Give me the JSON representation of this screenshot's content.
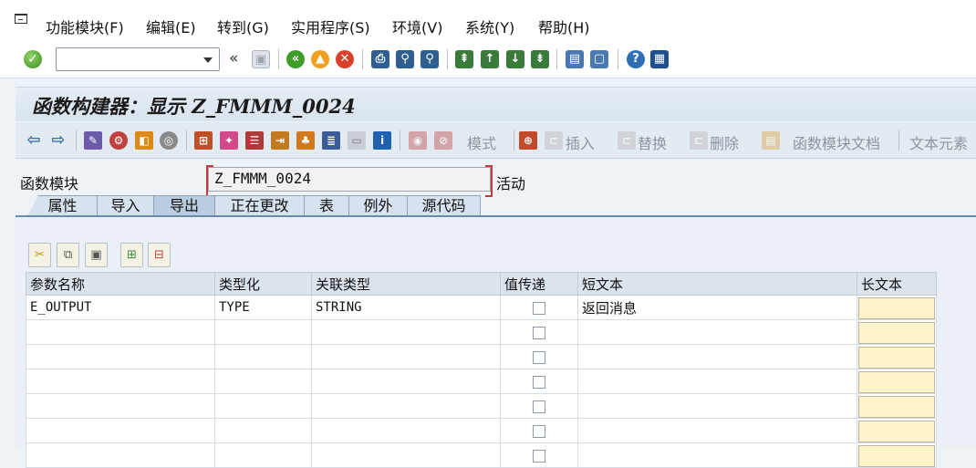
{
  "menu": {
    "items": [
      "功能模块(F)",
      "编辑(E)",
      "转到(G)",
      "实用程序(S)",
      "环境(V)",
      "系统(Y)",
      "帮助(H)"
    ]
  },
  "system_toolbar": {
    "command_field_value": "",
    "back_symbol": "«"
  },
  "title": "函数构建器：显示 Z_FMMM_0024",
  "app_toolbar": {
    "labels": [
      "模式",
      "插入",
      "替换",
      "删除",
      "函数模块文档",
      "文本元素"
    ]
  },
  "form": {
    "field_label": "函数模块",
    "field_value": "Z_FMMM_0024",
    "status": "活动"
  },
  "tabs": [
    "属性",
    "导入",
    "导出",
    "正在更改",
    "表",
    "例外",
    "源代码"
  ],
  "active_tab": "导出",
  "table": {
    "columns": [
      "参数名称",
      "类型化",
      "关联类型",
      "值传递",
      "短文本",
      "长文本"
    ],
    "rows": [
      {
        "name": "E_OUTPUT",
        "typing": "TYPE",
        "ref_type": "STRING",
        "pass_by_value": false,
        "short_text": "返回消息"
      },
      {
        "name": "",
        "typing": "",
        "ref_type": "",
        "pass_by_value": false,
        "short_text": ""
      },
      {
        "name": "",
        "typing": "",
        "ref_type": "",
        "pass_by_value": false,
        "short_text": ""
      },
      {
        "name": "",
        "typing": "",
        "ref_type": "",
        "pass_by_value": false,
        "short_text": ""
      },
      {
        "name": "",
        "typing": "",
        "ref_type": "",
        "pass_by_value": false,
        "short_text": ""
      },
      {
        "name": "",
        "typing": "",
        "ref_type": "",
        "pass_by_value": false,
        "short_text": ""
      },
      {
        "name": "",
        "typing": "",
        "ref_type": "",
        "pass_by_value": false,
        "short_text": ""
      }
    ]
  },
  "colors": {
    "long_text_cell": "#fff3c9",
    "active_tab": "#b9cde0",
    "title_bar": "#dde7f0"
  }
}
